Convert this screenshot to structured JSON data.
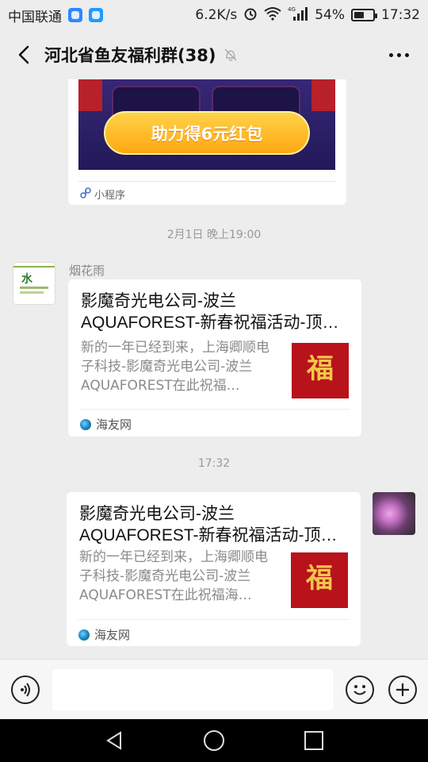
{
  "status_bar": {
    "carrier": "中国联通",
    "speed": "6.2K/s",
    "network": "4G",
    "battery": "54%",
    "battery_level": 0.54,
    "time": "17:32"
  },
  "header": {
    "title": "河北省鱼友福利群(38)"
  },
  "messages": {
    "mini_program": {
      "button_text": "助力得6元红包",
      "footer_label": "小程序"
    },
    "timestamp_1": "2月1日 晚上19:00",
    "msg1": {
      "sender": "烟花雨",
      "avatar_text": "水",
      "title_line1": "影魔奇光电公司-波兰",
      "title_line2": "AQUAFOREST-新春祝福活动-顶…",
      "desc": "新的一年已经到来，上海卿顺电子科技-影魔奇光电公司-波兰AQUAFOREST在此祝福…",
      "thumb_text": "福",
      "source": "海友网"
    },
    "timestamp_2": "17:32",
    "msg2": {
      "title_line1": "影魔奇光电公司-波兰",
      "title_line2": "AQUAFOREST-新春祝福活动-顶…",
      "desc": "新的一年已经到来，上海卿顺电子科技-影魔奇光电公司-波兰AQUAFOREST在此祝福海…",
      "thumb_text": "福",
      "source": "海友网"
    }
  },
  "input_bar": {
    "placeholder": ""
  },
  "icons": {
    "back": "chevron-left-icon",
    "mute": "bell-off-icon",
    "more": "more-dots-icon",
    "voice": "voice-icon",
    "emoji": "emoji-icon",
    "plus": "plus-icon"
  }
}
